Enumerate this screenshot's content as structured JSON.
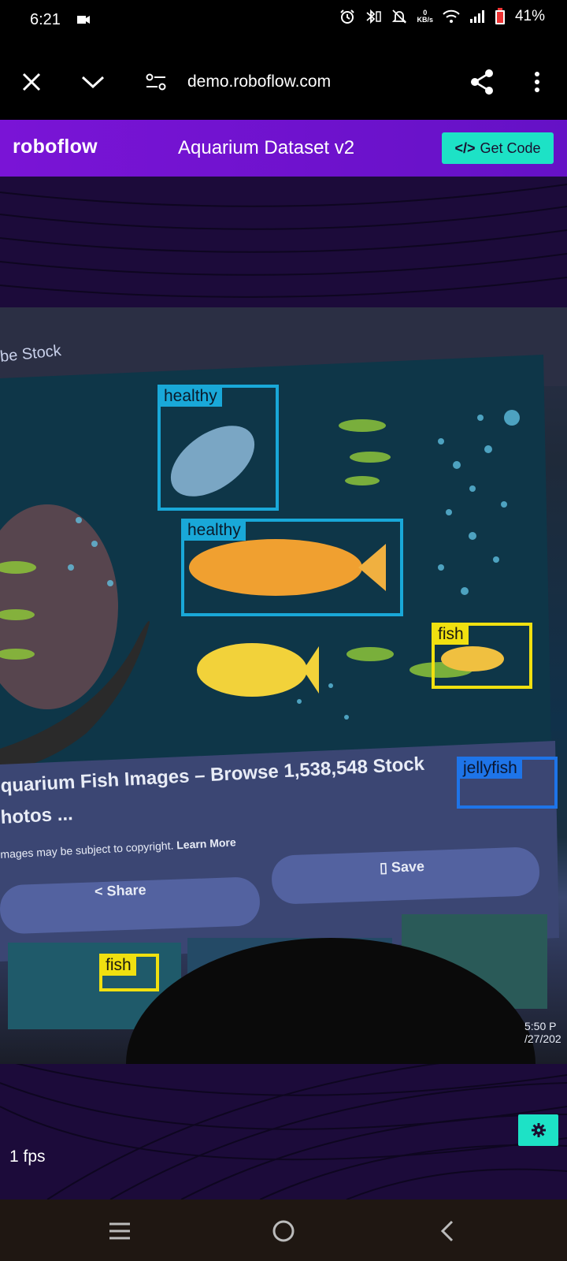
{
  "status": {
    "time": "6:21",
    "net_speed_value": "0",
    "net_speed_unit": "KB/s",
    "battery": "41%"
  },
  "browser": {
    "url": "demo.roboflow.com",
    "icons": [
      "close-icon",
      "chevron-down-icon",
      "site-settings-icon",
      "share-icon",
      "more-vert-icon"
    ]
  },
  "app": {
    "logo": "roboflow",
    "title": "Aquarium Dataset v2",
    "get_code_label": "Get Code",
    "fps": "1 fps"
  },
  "feed": {
    "source_label": "be Stock",
    "page_title_line1": "quarium Fish Images – Browse 1,538,548 Stock",
    "page_title_line2": "hotos ...",
    "copyright_text": "mages may be subject to copyright.",
    "learn_more": "Learn More",
    "share_label": "Share",
    "save_label": "Save",
    "timestamp_time": "5:50 P",
    "timestamp_date": "/27/202"
  },
  "detections": [
    {
      "label": "healthy",
      "class": "healthy"
    },
    {
      "label": "healthy",
      "class": "healthy"
    },
    {
      "label": "fish",
      "class": "fish"
    },
    {
      "label": "jellyfish",
      "class": "jellyfish"
    },
    {
      "label": "fish",
      "class": "fish"
    }
  ],
  "colors": {
    "brand_purple": "#7a14d6",
    "accent_teal": "#1de2c6",
    "healthy_box": "#19a8d8",
    "fish_box": "#f0e010",
    "jellyfish_box": "#1e74e8",
    "background": "#1c0b3a"
  }
}
